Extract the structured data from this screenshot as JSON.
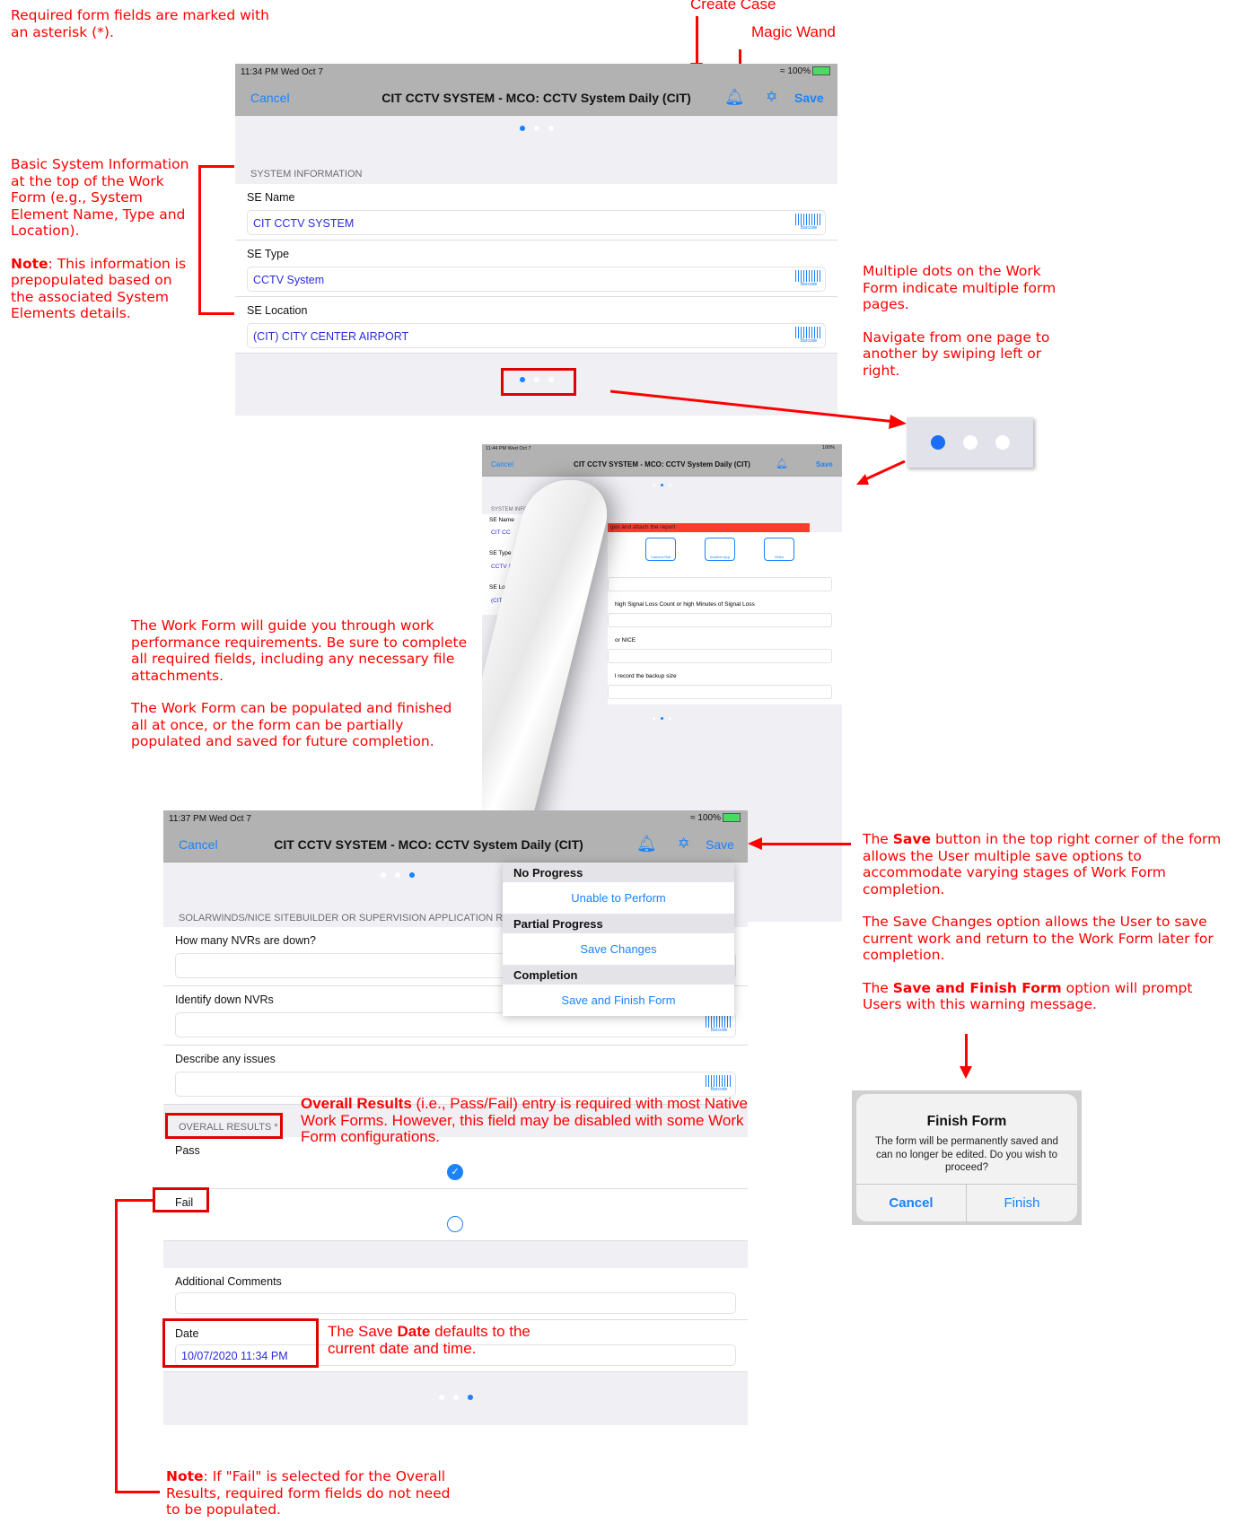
{
  "annotations": {
    "required_note": "Required form fields are marked with an asterisk (*).",
    "create_case": "Create Case",
    "magic_wand": "Magic Wand",
    "basic_info": "Basic System Information at the top of the Work Form (e.g., System Element Name, Type and Location).",
    "basic_note_label": "Note",
    "basic_note_text": ": This information is prepopulated based on the associated System Elements details.",
    "dots_p1": "Multiple dots on the Work Form indicate multiple form pages.",
    "dots_p2": "Navigate from one page to another by swiping left or right.",
    "guide_p1": "The Work Form will guide you through work performance requirements. Be sure to complete all required fields, including any necessary file attachments.",
    "guide_p2": "The Work Form can be populated and finished all at once, or the form can be partially populated and saved for future completion.",
    "save_p1_pre": "The ",
    "save_p1_bold": "Save",
    "save_p1_post": " button in the top right corner of the form allows the User multiple save options to accommodate varying stages of Work Form completion.",
    "save_p2": "The Save Changes option allows the User to save current work and return to the Work Form later for completion.",
    "save_p3_pre": "The ",
    "save_p3_bold": "Save and Finish Form",
    "save_p3_post": " option will prompt Users with this warning message.",
    "overall_bold": "Overall Results",
    "overall_text": " (i.e., Pass/Fail) entry is required with most Native Work Forms. However, this field may be disabled with some Work Form configurations.",
    "date_pre": "The Save ",
    "date_bold": "Date",
    "date_post": " defaults to the current date and time.",
    "fail_note_label": "Note",
    "fail_note_text": ": If \"Fail\" is selected for the Overall Results, required form fields do not need to be populated."
  },
  "common": {
    "cancel": "Cancel",
    "save": "Save",
    "title": "CIT CCTV SYSTEM - MCO: CCTV System Daily (CIT)",
    "status_right": "100%",
    "barcode": "Barcode",
    "bell_icon": "🔔",
    "wand_icon": "✨"
  },
  "screen1": {
    "status_time": "11:34 PM   Wed Oct 7",
    "section": "SYSTEM INFORMATION",
    "fields": [
      {
        "label": "SE Name",
        "value": "CIT CCTV SYSTEM"
      },
      {
        "label": "SE Type",
        "value": "CCTV System"
      },
      {
        "label": "SE Location",
        "value": "(CIT) CITY CENTER AIRPORT"
      }
    ],
    "page_indicator": {
      "current": 1,
      "total": 3
    }
  },
  "screen2": {
    "status_time": "11:44 PM   Wed Oct 7",
    "section": "SYSTEM INFORMATION",
    "banner": "ges and attach the report",
    "attach_buttons": [
      "Camera Roll",
      "Another App",
      "Video"
    ],
    "fields": [
      {
        "label": "SE Name",
        "value": "CIT CC"
      },
      {
        "label": "SE Type",
        "value": "CCTV Syst"
      },
      {
        "label": "SE Location",
        "value": "(CIT) CITY CE"
      }
    ],
    "partial_labels": [
      "high Signal Loss Count or high Minutes of Signal Loss",
      "or NICE",
      "l record the backup size"
    ],
    "page_indicator": {
      "current": 2,
      "total": 3
    }
  },
  "screen3": {
    "status_time": "11:37 PM   Wed Oct 7",
    "section": "SOLARWINDS/NICE SITEBUILDER OR SUPERVISION APPLICATION REPORT",
    "fields": [
      {
        "label": "How many NVRs are down?",
        "value": ""
      },
      {
        "label": "Identify down NVRs",
        "value": ""
      },
      {
        "label": "Describe any issues",
        "value": ""
      }
    ],
    "overall_section": "OVERALL RESULTS *",
    "results": [
      {
        "label": "Pass",
        "selected": true
      },
      {
        "label": "Fail",
        "selected": false
      }
    ],
    "comments_label": "Additional Comments",
    "comments_value": "",
    "date_label": "Date",
    "date_value": "10/07/2020 11:34 PM",
    "page_indicator": {
      "current": 3,
      "total": 3
    },
    "save_menu": [
      {
        "group": "No Progress",
        "option": "Unable to Perform"
      },
      {
        "group": "Partial Progress",
        "option": "Save Changes"
      },
      {
        "group": "Completion",
        "option": "Save and Finish Form"
      }
    ]
  },
  "dialog": {
    "title": "Finish Form",
    "message": "The form will be permanently saved and can no longer be edited. Do you wish to proceed?",
    "cancel": "Cancel",
    "finish": "Finish"
  },
  "colors": {
    "annotation": "#ff0000",
    "ios_blue": "#1a82fb",
    "navbar": "#b2b2b2",
    "background": "#efeff4"
  }
}
